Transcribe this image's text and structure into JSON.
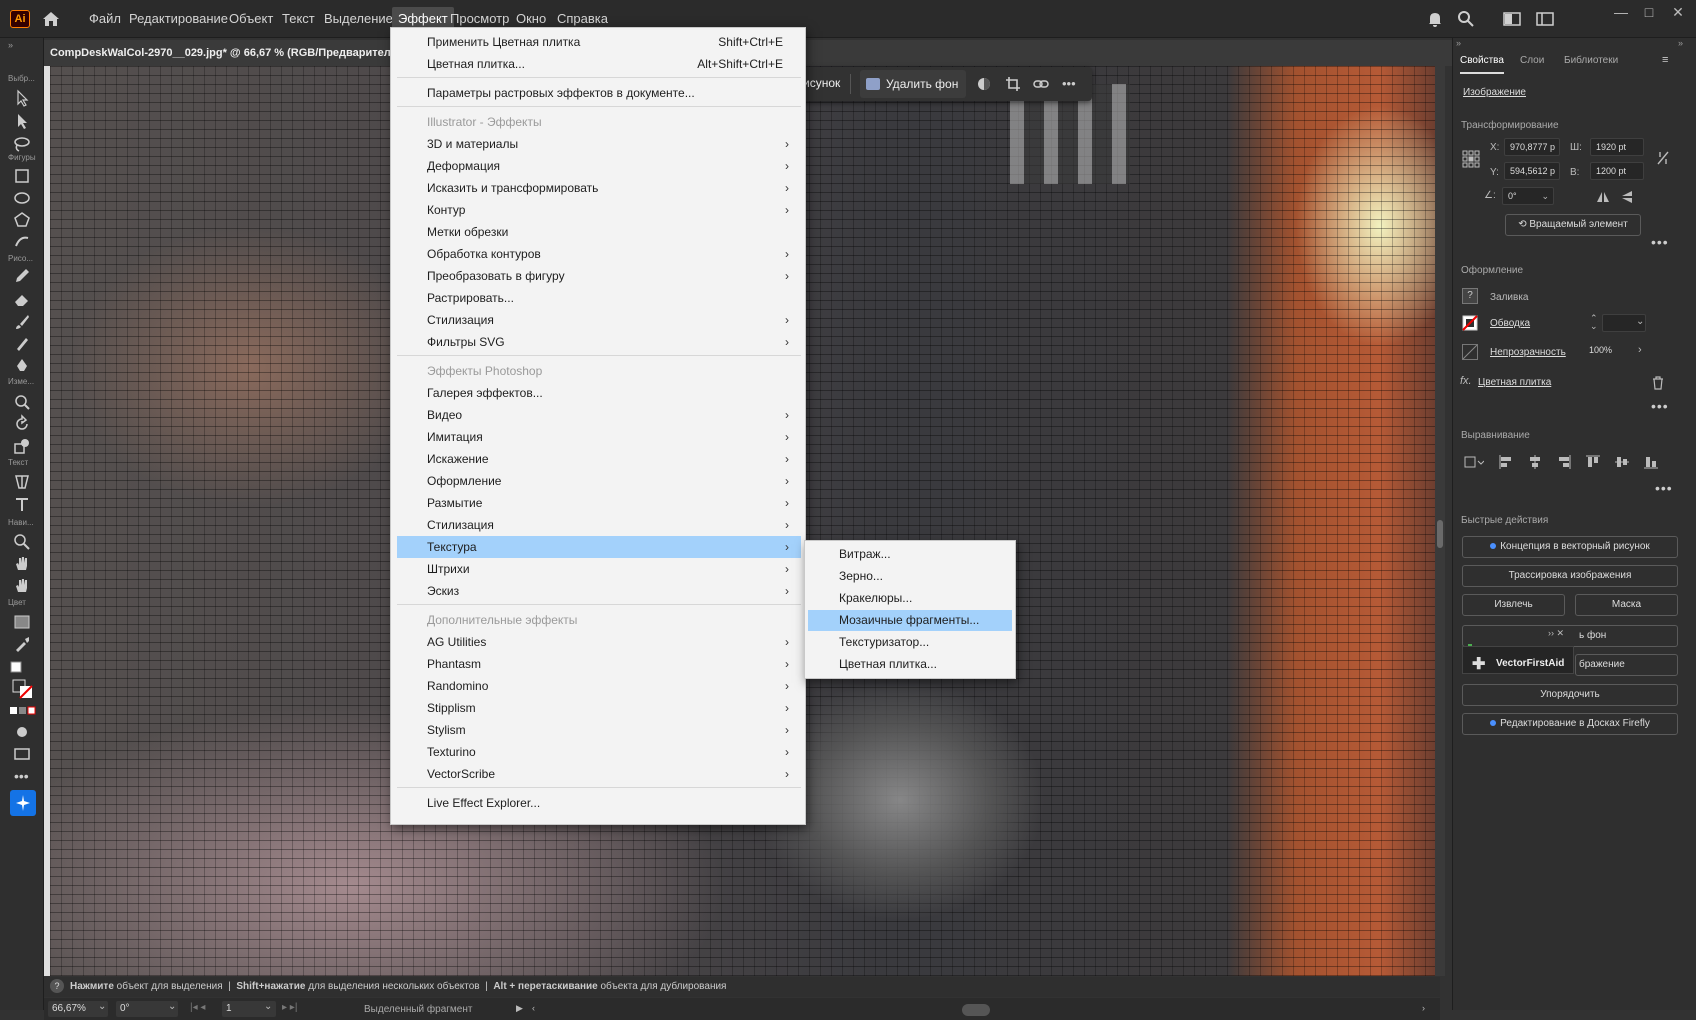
{
  "app": {
    "logo": "Ai",
    "menu": [
      "Файл",
      "Редактирование",
      "Объект",
      "Текст",
      "Выделение",
      "Эффект",
      "Просмотр",
      "Окно",
      "Справка"
    ],
    "active_menu": "Эффект",
    "window_controls": [
      "—",
      "□",
      "✕"
    ]
  },
  "document": {
    "tab_title": "CompDeskWalCol-2970__029.jpg* @ 66,67 % (RGB/Предварительны"
  },
  "toolbar": {
    "labels": [
      "Выбр...",
      "Фигуры",
      "Рисо...",
      "Изме...",
      "Текст",
      "Нави...",
      "Цвет"
    ]
  },
  "context_bar": {
    "partial_label": "исунок",
    "remove_bg_label": "Удалить фон"
  },
  "effect_menu": {
    "apply_last": "Применить Цветная плитка",
    "apply_last_shortcut": "Shift+Ctrl+E",
    "last_effect": "Цветная плитка...",
    "last_effect_shortcut": "Alt+Shift+Ctrl+E",
    "raster_settings": "Параметры растровых эффектов в документе...",
    "illustrator_header": "Illustrator - Эффекты",
    "illustrator_items": [
      "3D и материалы",
      "Деформация",
      "Исказить и трансформировать",
      "Контур",
      "Метки обрезки",
      "Обработка контуров",
      "Преобразовать в фигуру",
      "Растрировать...",
      "Стилизация",
      "Фильтры SVG"
    ],
    "photoshop_header": "Эффекты Photoshop",
    "photoshop_items": [
      "Галерея эффектов...",
      "Видео",
      "Имитация",
      "Искажение",
      "Оформление",
      "Размытие",
      "Стилизация",
      "Текстура",
      "Штрихи",
      "Эскиз"
    ],
    "extra_header": "Дополнительные эффекты",
    "extra_items": [
      "AG Utilities",
      "Phantasm",
      "Randomino",
      "Stipplism",
      "Stylism",
      "Texturino",
      "VectorScribe"
    ],
    "explorer": "Live Effect Explorer..."
  },
  "texture_submenu": {
    "items": [
      "Витраж...",
      "Зерно...",
      "Кракелюры...",
      "Мозаичные фрагменты...",
      "Текстуризатор...",
      "Цветная плитка..."
    ],
    "highlighted": "Мозаичные фрагменты..."
  },
  "panel": {
    "tabs": [
      "Свойства",
      "Слои",
      "Библиотеки"
    ],
    "object_type": "Изображение",
    "transform": {
      "title": "Трансформирование",
      "x_label": "X:",
      "x": "970,8777 p",
      "y_label": "Y:",
      "y": "594,5612 p",
      "w_label": "Ш:",
      "w": "1920 pt",
      "h_label": "В:",
      "h": "1200 pt",
      "angle": "0°",
      "rotate_button": "Вращаемый элемент"
    },
    "appearance": {
      "title": "Оформление",
      "fill": "Заливка",
      "stroke": "Обводка",
      "opacity_label": "Непрозрачность",
      "opacity": "100%",
      "effect": "Цветная плитка"
    },
    "align": {
      "title": "Выравнивание"
    },
    "quick_actions": {
      "title": "Быстрые действия",
      "vectorize": "Концепция в векторный рисунок",
      "trace": "Трассировка изображения",
      "extract": "Извлечь",
      "mask": "Маска",
      "remove_bg_partial": "ь фон",
      "plugin_name": "VectorFirstAid",
      "image_partial": "бражение",
      "arrange": "Упорядочить",
      "firefly": "Редактирование в Досках Firefly"
    }
  },
  "hint_bar": {
    "click": "Нажмите",
    "click_text": "объект для выделения",
    "shift": "Shift+нажатие",
    "shift_text": "для выделения нескольких объектов",
    "alt": "Alt + перетаскивание",
    "alt_text": "объекта для дублирования"
  },
  "status_bar": {
    "zoom": "66,67%",
    "rotation": "0°",
    "artboard": "1",
    "selection": "Выделенный фрагмент"
  }
}
